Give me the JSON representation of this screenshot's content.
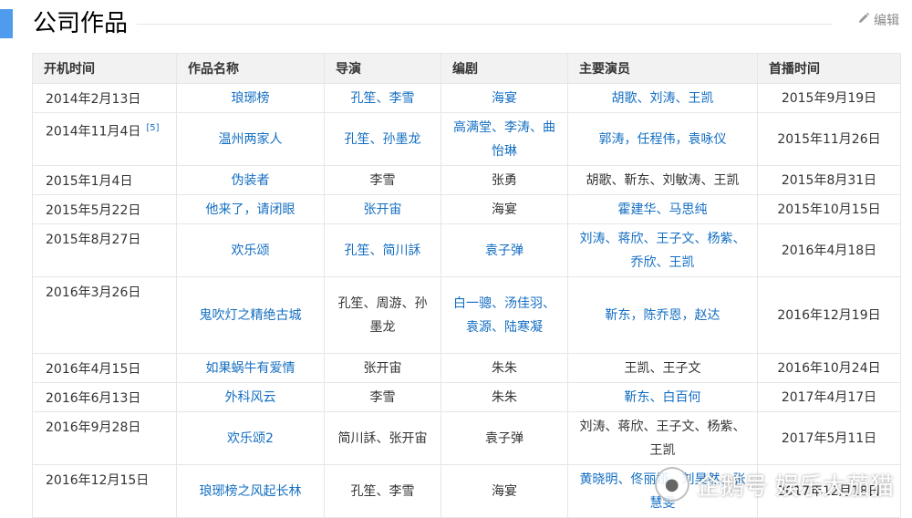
{
  "section": {
    "title": "公司作品",
    "edit_label": "编辑"
  },
  "table": {
    "headers": [
      "开机时间",
      "作品名称",
      "导演",
      "编剧",
      "主要演员",
      "首播时间"
    ],
    "rows": [
      {
        "start": "2014年2月13日",
        "title": "琅琊榜",
        "director": "孔笙、李雪",
        "writer": "海宴",
        "cast": "胡歌、刘涛、王凯",
        "premiere": "2015年9月19日"
      },
      {
        "start": "2014年11月4日",
        "ref": "[5]",
        "title": "温州两家人",
        "director": "孔笙、孙墨龙",
        "writer": "高满堂、李涛、曲怡琳",
        "cast": "郭涛，任程伟，袁咏仪",
        "premiere": "2015年11月26日"
      },
      {
        "start": "2015年1月4日",
        "title": "伪装者",
        "director": "李雪",
        "writer": "张勇",
        "cast": "胡歌、靳东、刘敏涛、王凯",
        "premiere": "2015年8月31日"
      },
      {
        "start": "2015年5月22日",
        "title": "他来了，请闭眼",
        "director": "张开宙",
        "writer": "海宴",
        "cast": "霍建华、马思纯",
        "premiere": "2015年10月15日"
      },
      {
        "start": "2015年8月27日",
        "title": "欢乐颂",
        "director": "孔笙、简川訸",
        "writer": "袁子弹",
        "cast": "刘涛、蒋欣、王子文、杨紫、乔欣、王凯",
        "premiere": "2016年4月18日"
      },
      {
        "start": "2016年3月26日",
        "title": "鬼吹灯之精绝古城",
        "director": "孔笙、周游、孙墨龙",
        "writer": "白一骢、汤佳羽、袁源、陆寒凝",
        "cast": "靳东，陈乔恩，赵达",
        "premiere": "2016年12月19日"
      },
      {
        "start": "2016年4月15日",
        "title": "如果蜗牛有爱情",
        "director": "张开宙",
        "writer": "朱朱",
        "cast": "王凯、王子文",
        "premiere": "2016年10月24日"
      },
      {
        "start": "2016年6月13日",
        "title": "外科风云",
        "director": "李雪",
        "writer": "朱朱",
        "cast": "靳东、白百何",
        "premiere": "2017年4月17日"
      },
      {
        "start": "2016年9月28日",
        "title": "欢乐颂2",
        "director": "简川訸、张开宙",
        "writer": "袁子弹",
        "cast": "刘涛、蒋欣、王子文、杨紫、王凯",
        "premiere": "2017年5月11日"
      },
      {
        "start": "2016年12月15日",
        "title": "琅琊榜之风起长林",
        "director": "孔笙、李雪",
        "writer": "海宴",
        "cast": "黄晓明、佟丽娅、刘昊然、张慧雯",
        "premiere": "2017年12月18日"
      }
    ]
  },
  "watermark": {
    "text": "企鹅号 娱乐大茄猫"
  },
  "colors": {
    "accent": "#4f9cee",
    "link": "#136ec2",
    "header_bg": "#f2f2f2",
    "border": "#e6e6e6"
  }
}
